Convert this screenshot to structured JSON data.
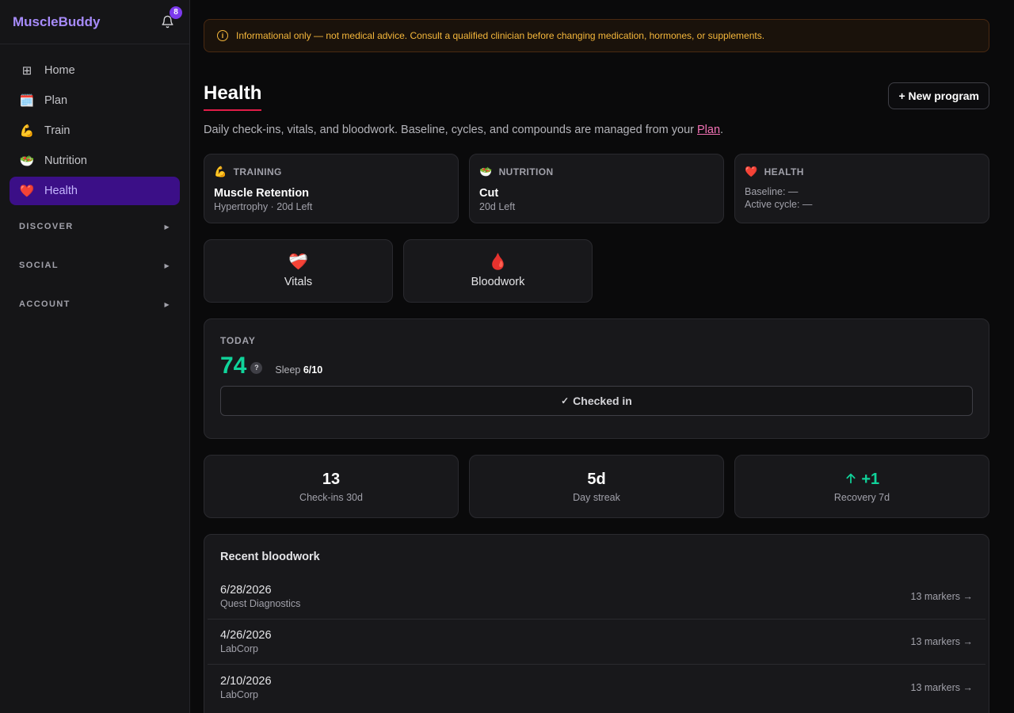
{
  "app": {
    "brand": "MuscleBuddy",
    "notifications_count": "8"
  },
  "sidebar": {
    "items": [
      {
        "label": "Home",
        "icon": "⊞",
        "icon_name": "home-grid-icon",
        "active": false
      },
      {
        "label": "Plan",
        "icon": "🗓️",
        "icon_name": "calendar-icon",
        "active": false
      },
      {
        "label": "Train",
        "icon": "💪",
        "icon_name": "flexed-arm-icon",
        "active": false
      },
      {
        "label": "Nutrition",
        "icon": "🥗",
        "icon_name": "salad-icon",
        "active": false
      },
      {
        "label": "Health",
        "icon": "❤️",
        "icon_name": "heart-icon",
        "active": true
      }
    ],
    "sections": [
      "DISCOVER",
      "SOCIAL",
      "ACCOUNT"
    ]
  },
  "disclaimer": "Informational only — not medical advice. Consult a qualified clinician before changing medication, hormones, or supplements.",
  "page": {
    "title": "Health",
    "new_button": "+ New program",
    "subtitle_before": "Daily check-ins, vitals, and bloodwork. Baseline, cycles, and compounds are managed from your ",
    "subtitle_link": "Plan",
    "subtitle_after": "."
  },
  "programs": {
    "training": {
      "icon": "💪",
      "label": "TRAINING",
      "name": "Muscle Retention",
      "meta": "Hypertrophy · 20d Left"
    },
    "nutrition": {
      "icon": "🥗",
      "label": "NUTRITION",
      "name": "Cut",
      "meta": "20d Left"
    },
    "health": {
      "icon": "❤️",
      "label": "HEALTH",
      "baseline": "Baseline: —",
      "active_cycle": "Active cycle: —"
    }
  },
  "quick": {
    "vitals": {
      "icon": "❤️‍🩹",
      "label": "Vitals"
    },
    "bloodwork": {
      "icon": "🩸",
      "label": "Bloodwork"
    }
  },
  "today": {
    "label": "TODAY",
    "score": "74",
    "help": "?",
    "sleep_label": "Sleep",
    "sleep_value": "6/10",
    "check": "✓",
    "button": "Checked in"
  },
  "stats": [
    {
      "value": "13",
      "label": "Check-ins 30d"
    },
    {
      "value": "5d",
      "label": "Day streak"
    },
    {
      "value": "+1",
      "label": "Recovery 7d"
    }
  ],
  "bloodwork": {
    "title": "Recent bloodwork",
    "rows": [
      {
        "date": "6/28/2026",
        "lab": "Quest Diagnostics",
        "markers": "13 markers →"
      },
      {
        "date": "4/26/2026",
        "lab": "LabCorp",
        "markers": "13 markers →"
      },
      {
        "date": "2/10/2026",
        "lab": "LabCorp",
        "markers": "13 markers →"
      }
    ]
  },
  "colors": {
    "accent": "#a78bfa",
    "active_bg": "#3b0f87",
    "score": "#10d39a",
    "warning": "#f5b73b",
    "title_underline": "#e11d48"
  }
}
